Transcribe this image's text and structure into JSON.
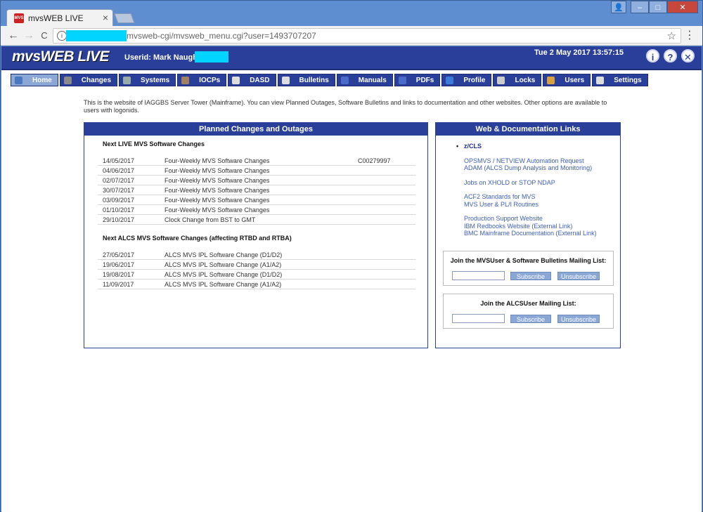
{
  "browser": {
    "tab_title": "mvsWEB LIVE",
    "tab_close": "×",
    "favicon_text": "MVS",
    "url": "mvsweb-cgi/mvsweb_menu.cgi?user=1493707207",
    "win_buttons": {
      "user": "👤",
      "minimize": "–",
      "maximize": "□",
      "close": "✕"
    },
    "nav": {
      "back": "←",
      "forward": "→",
      "reload": "C"
    },
    "info": "i",
    "star": "☆",
    "menu": "⋮"
  },
  "header": {
    "logo": "mvsWEB LIVE",
    "userid_label": "Userid: Mark Naughton",
    "datetime": "Tue 2 May 2017 13:57:15",
    "icons": {
      "info": "i",
      "help": "?",
      "close": "✕"
    }
  },
  "nav": [
    {
      "label": "Home",
      "icon": "home-icon",
      "color": "#4a78c0"
    },
    {
      "label": "Changes",
      "icon": "changes-icon",
      "color": "#8a8a8a"
    },
    {
      "label": "Systems",
      "icon": "systems-icon",
      "color": "#9aa"
    },
    {
      "label": "IOCPs",
      "icon": "iocps-icon",
      "color": "#a08060"
    },
    {
      "label": "DASD",
      "icon": "dasd-icon",
      "color": "#ddd"
    },
    {
      "label": "Bulletins",
      "icon": "bulletins-icon",
      "color": "#ddd"
    },
    {
      "label": "Manuals",
      "icon": "manuals-icon",
      "color": "#4a6cc8"
    },
    {
      "label": "PDFs",
      "icon": "pdfs-icon",
      "color": "#4a6cc8"
    },
    {
      "label": "Profile",
      "icon": "profile-icon",
      "color": "#3a7cd8"
    },
    {
      "label": "Locks",
      "icon": "locks-icon",
      "color": "#ccc"
    },
    {
      "label": "Users",
      "icon": "users-icon",
      "color": "#d8a040"
    },
    {
      "label": "Settings",
      "icon": "settings-icon",
      "color": "#ddd"
    }
  ],
  "intro": "This is the website of IAGGBS Server Tower (Mainframe). You can view Planned Outages, Software Bulletins and links to documentation and other websites. Other options are available to users with logonids.",
  "planned": {
    "title": "Planned Changes and Outages",
    "mvs_head": "Next LIVE MVS Software Changes",
    "mvs_rows": [
      {
        "date": "14/05/2017",
        "desc": "Four-Weekly MVS Software Changes",
        "ref": "C00279997"
      },
      {
        "date": "04/06/2017",
        "desc": "Four-Weekly MVS Software Changes",
        "ref": ""
      },
      {
        "date": "02/07/2017",
        "desc": "Four-Weekly MVS Software Changes",
        "ref": ""
      },
      {
        "date": "30/07/2017",
        "desc": "Four-Weekly MVS Software Changes",
        "ref": ""
      },
      {
        "date": "03/09/2017",
        "desc": "Four-Weekly MVS Software Changes",
        "ref": ""
      },
      {
        "date": "01/10/2017",
        "desc": "Four-Weekly MVS Software Changes",
        "ref": ""
      },
      {
        "date": "29/10/2017",
        "desc": "Clock Change from BST to GMT",
        "ref": ""
      }
    ],
    "alcs_head": "Next ALCS MVS Software Changes (affecting RTBD and RTBA)",
    "alcs_rows": [
      {
        "date": "27/05/2017",
        "desc": "ALCS MVS IPL Software Change (D1/D2)"
      },
      {
        "date": "19/06/2017",
        "desc": "ALCS MVS IPL Software Change (A1/A2)"
      },
      {
        "date": "19/08/2017",
        "desc": "ALCS MVS IPL Software Change (D1/D2)"
      },
      {
        "date": "11/09/2017",
        "desc": "ALCS MVS IPL Software Change (A1/A2)"
      }
    ]
  },
  "links": {
    "title": "Web & Documentation Links",
    "groups": [
      [
        "z/CLS"
      ],
      [
        "OPSMVS / NETVIEW Automation Request",
        "ADAM (ALCS Dump Analysis and Monitoring)"
      ],
      [
        "Jobs on XHOLD or STOP NDAP"
      ],
      [
        "ACF2 Standards for MVS",
        "MVS User & PL/I Routines"
      ],
      [
        "Production Support Website",
        "IBM Redbooks Website (External Link)",
        "BMC Mainframe Documentation (External Link)"
      ]
    ]
  },
  "mailing": [
    {
      "title": "Join the MVSUser & Software Bulletins Mailing List:",
      "subscribe": "Subscribe",
      "unsubscribe": "Unsubscribe"
    },
    {
      "title": "Join the ALCSUser Mailing List:",
      "subscribe": "Subscribe",
      "unsubscribe": "Unsubscribe"
    }
  ]
}
